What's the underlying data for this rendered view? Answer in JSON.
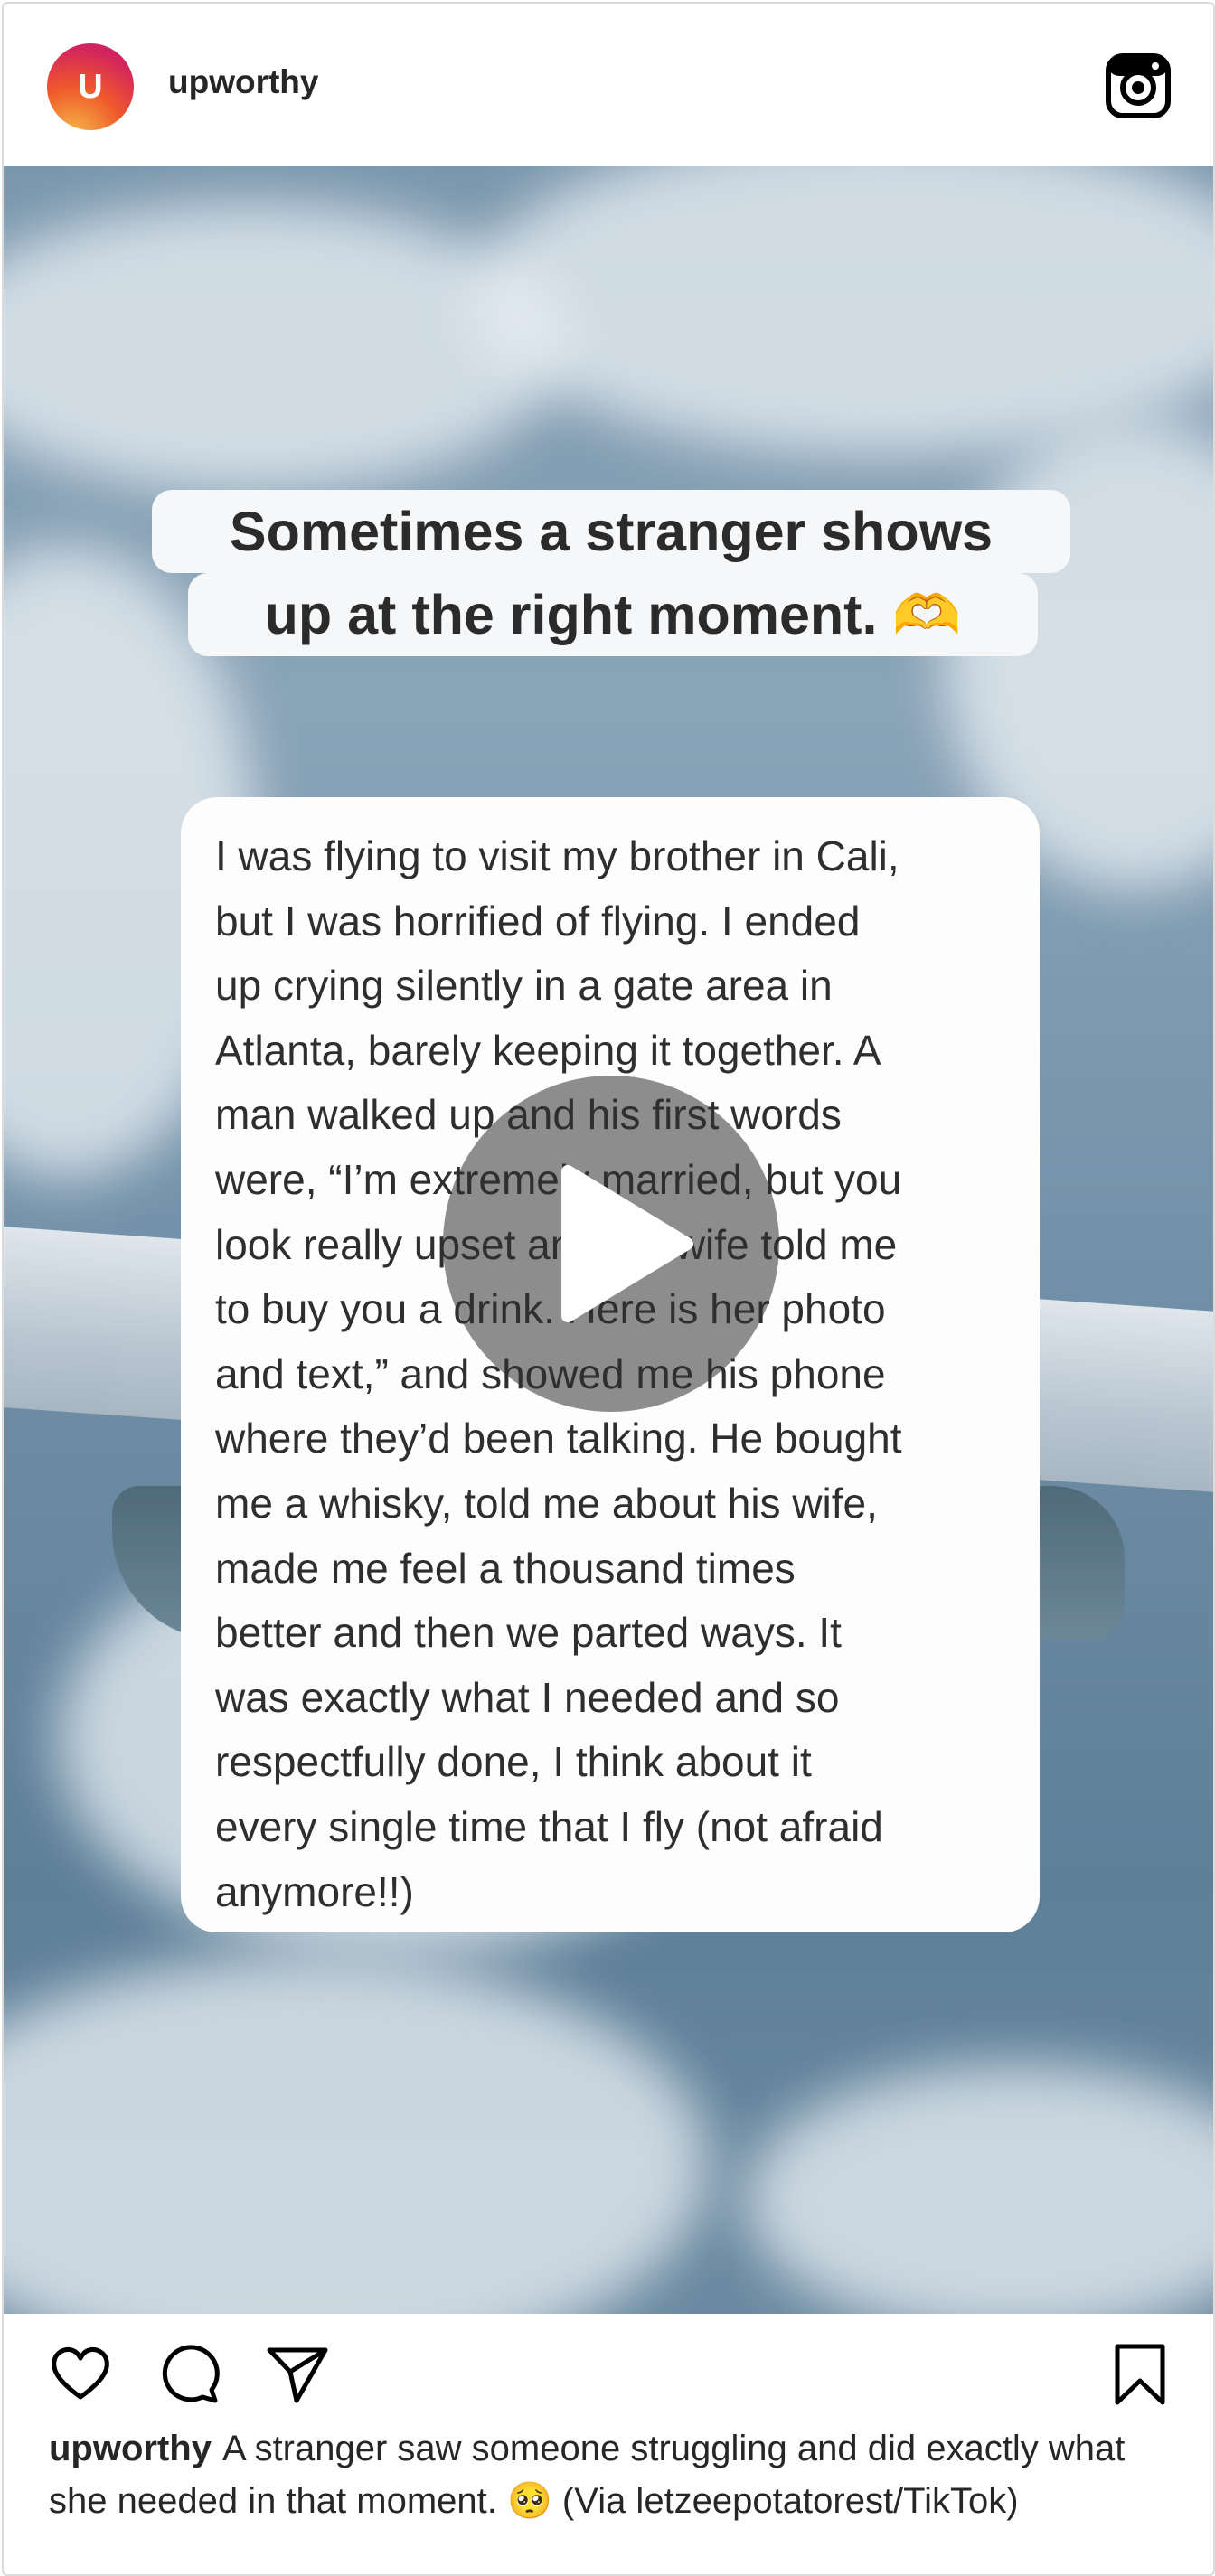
{
  "post": {
    "avatar_letter": "U",
    "username": "upworthy"
  },
  "media": {
    "title_line1": "Sometimes a stranger shows",
    "title_line2": "up at the right moment.",
    "title_emoji": "🫶",
    "story": "I was flying to visit my brother in Cali,\nbut I was horrified of flying. I ended\nup crying silently in a gate area in\nAtlanta, barely keeping it together. A\nman walked up and his first words\nwere, “I’m extremely married, but you\nlook really upset and my wife told me\nto buy you a drink. Here is her photo\nand text,” and showed me his phone\nwhere they’d been talking. He bought\nme a whisky, told me about his wife,\nmade me feel a thousand times\nbetter and then we parted ways. It\nwas exactly what I needed and so\nrespectfully done, I think about it\nevery single time that I fly (not afraid\nanymore!!)"
  },
  "caption": {
    "username": "upworthy",
    "text": "A stranger saw someone struggling and did exactly what she needed in that moment. 🥺 (Via letzeepotatorest/TikTok)"
  },
  "icons": {
    "brand": "instagram-icon",
    "like": "heart-icon",
    "comment": "comment-icon",
    "share": "send-icon",
    "save": "bookmark-icon",
    "play": "play-icon"
  }
}
